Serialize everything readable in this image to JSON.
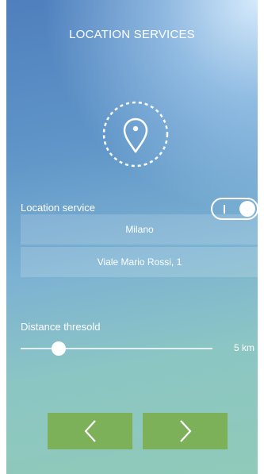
{
  "header": {
    "title": "LOCATION SERVICES"
  },
  "icons": {
    "location": "location-pin-icon",
    "prev": "chevron-left-icon",
    "next": "chevron-right-icon"
  },
  "location_service": {
    "label": "Location service",
    "enabled": true,
    "toggle_mark": "I"
  },
  "address": {
    "city": "Milano",
    "street": "Viale Mario Rossi, 1"
  },
  "distance": {
    "label": "Distance thresold",
    "value_label": "5 km",
    "slider_fraction": 0.2
  },
  "colors": {
    "nav_button": "#7cb15a",
    "text": "#ffffff"
  }
}
